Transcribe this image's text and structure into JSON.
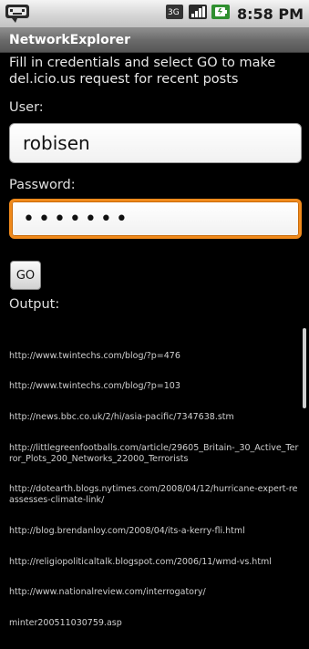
{
  "status_bar": {
    "time": "8:58 PM",
    "icons": [
      "notification-icon",
      "network-3g-icon",
      "signal-icon",
      "battery-icon"
    ]
  },
  "app": {
    "title": "NetworkExplorer"
  },
  "form": {
    "instructions": "Fill in credentials and select GO to make del.icio.us request for recent posts",
    "user_label": "User:",
    "user_value": "robisen",
    "password_label": "Password:",
    "password_value": "•••••••",
    "go_label": "GO",
    "output_label": "Output:"
  },
  "output_lines": [
    "http://www.twintechs.com/blog/?p=476",
    "http://www.twintechs.com/blog/?p=103",
    "http://news.bbc.co.uk/2/hi/asia-pacific/7347638.stm",
    "http://littlegreenfootballs.com/article/29605_Britain-_30_Active_Terror_Plots_200_Networks_22000_Terrorists",
    "http://dotearth.blogs.nytimes.com/2008/04/12/hurricane-expert-reassesses-climate-link/",
    "http://blog.brendanloy.com/2008/04/its-a-kerry-fli.html",
    "http://religiopoliticaltalk.blogspot.com/2006/11/wmd-vs.html",
    "http://www.nationalreview.com/interrogatory/",
    "minter200511030759.asp"
  ],
  "colors": {
    "focus": "#f08a1c",
    "background": "#000000"
  }
}
